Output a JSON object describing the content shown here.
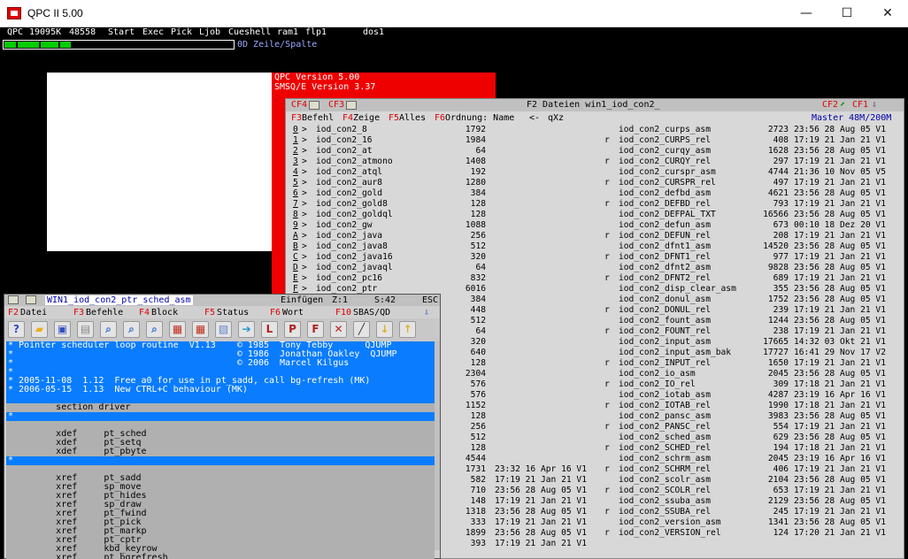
{
  "window": {
    "title": "QPC II 5.00",
    "minimize": "—",
    "maximize": "☐",
    "close": "✕"
  },
  "qbar": {
    "qpc": "QPC",
    "mem": "19095K",
    "free": "48558",
    "start": "Start",
    "exec": "Exec",
    "pick": "Pick",
    "ljob": "Ljob",
    "cueshell": "Cueshell",
    "ram1": "ram1",
    "flp1": "flp1",
    "dos1": "dos1"
  },
  "progress": {
    "label": "0D Zeile/Spalte",
    "fraction": 0.29
  },
  "version": {
    "line1": "QPC Version 5.00",
    "line2": "SMSQ/E Version 3.37"
  },
  "files": {
    "title": "F2 Dateien win1_iod_con2_",
    "title_keys": {
      "cf4": "CF4",
      "cf3": "CF3",
      "cf2": "CF2",
      "cf1": "CF1"
    },
    "menu": {
      "f3": "F3",
      "f3l": "Befehl",
      "f4": "F4",
      "f4l": "Zeige",
      "f5": "F5",
      "f5l": "Alles",
      "f6": "F6",
      "f6l": "Ordnung: Name",
      "sort": "<-",
      "qxz": "qXz",
      "master": "Master 48M/200M"
    },
    "left": [
      {
        "key": "0",
        "name": "iod_con2_8",
        "size": "1792"
      },
      {
        "key": "1",
        "name": "iod_con2_16",
        "size": "1984"
      },
      {
        "key": "2",
        "name": "iod_con2_at",
        "size": "64"
      },
      {
        "key": "3",
        "name": "iod_con2_atmono",
        "size": "1408"
      },
      {
        "key": "4",
        "name": "iod_con2_atql",
        "size": "192"
      },
      {
        "key": "5",
        "name": "iod_con2_aur8",
        "size": "1280"
      },
      {
        "key": "6",
        "name": "iod_con2_gold",
        "size": "384"
      },
      {
        "key": "7",
        "name": "iod_con2_gold8",
        "size": "128"
      },
      {
        "key": "8",
        "name": "iod_con2_goldql",
        "size": "128"
      },
      {
        "key": "9",
        "name": "iod_con2_gw",
        "size": "1088"
      },
      {
        "key": "A",
        "name": "iod_con2_java",
        "size": "256"
      },
      {
        "key": "B",
        "name": "iod_con2_java8",
        "size": "512"
      },
      {
        "key": "C",
        "name": "iod_con2_java16",
        "size": "320"
      },
      {
        "key": "D",
        "name": "iod_con2_javaql",
        "size": "64"
      },
      {
        "key": "E",
        "name": "iod_con2_pc16",
        "size": "832"
      },
      {
        "key": "F",
        "name": "iod_con2_ptr",
        "size": "6016"
      },
      {
        "key": "",
        "name": "",
        "size": "384"
      },
      {
        "key": "",
        "name": "",
        "size": "448"
      },
      {
        "key": "",
        "name": "",
        "size": "512"
      },
      {
        "key": "",
        "name": "",
        "size": "64"
      },
      {
        "key": "",
        "name": "",
        "size": "320"
      },
      {
        "key": "",
        "name": "",
        "size": "640"
      },
      {
        "key": "",
        "name": "",
        "size": "128"
      },
      {
        "key": "",
        "name": "",
        "size": "2304"
      },
      {
        "key": "",
        "name": "",
        "size": "576"
      },
      {
        "key": "",
        "name": "",
        "size": "576"
      },
      {
        "key": "",
        "name": "",
        "size": "1152"
      },
      {
        "key": "",
        "name": "",
        "size": "128"
      },
      {
        "key": "",
        "name": "",
        "size": "256"
      },
      {
        "key": "",
        "name": "",
        "size": "512"
      },
      {
        "key": "",
        "name": "",
        "size": "128"
      },
      {
        "key": "",
        "name": "",
        "size": "4544"
      },
      {
        "key": "",
        "name": "",
        "size": "1731",
        "date": "23:32 16 Apr 16 V1"
      },
      {
        "key": "",
        "name": "",
        "size": "582",
        "date": "17:19 21 Jan 21 V1"
      },
      {
        "key": "",
        "name": "",
        "size": "710",
        "date": "23:56 28 Aug 05 V1"
      },
      {
        "key": "",
        "name": "",
        "size": "148",
        "date": "17:19 21 Jan 21 V1"
      },
      {
        "key": "",
        "name": "",
        "size": "1318",
        "date": "23:56 28 Aug 05 V1"
      },
      {
        "key": "",
        "name": "",
        "size": "333",
        "date": "17:19 21 Jan 21 V1"
      },
      {
        "key": "",
        "name": "",
        "size": "1899",
        "date": "23:56 28 Aug 05 V1"
      },
      {
        "key": "",
        "name": "",
        "size": "393",
        "date": "17:19 21 Jan 21 V1"
      }
    ],
    "right": [
      {
        "r": "",
        "name": "iod_con2_curps_asm",
        "size": "2723",
        "date": "23:56 28 Aug 05 V1"
      },
      {
        "r": "r",
        "name": "iod_con2_CURPS_rel",
        "size": "408",
        "date": "17:19 21 Jan 21 V1"
      },
      {
        "r": "",
        "name": "iod_con2_curqy_asm",
        "size": "1628",
        "date": "23:56 28 Aug 05 V1"
      },
      {
        "r": "r",
        "name": "iod_con2_CURQY_rel",
        "size": "297",
        "date": "17:19 21 Jan 21 V1"
      },
      {
        "r": "",
        "name": "iod_con2_curspr_asm",
        "size": "4744",
        "date": "21:36 10 Nov 05 V5"
      },
      {
        "r": "r",
        "name": "iod_con2_CURSPR_rel",
        "size": "497",
        "date": "17:19 21 Jan 21 V1"
      },
      {
        "r": "",
        "name": "iod_con2_defbd_asm",
        "size": "4621",
        "date": "23:56 28 Aug 05 V1"
      },
      {
        "r": "r",
        "name": "iod_con2_DEFBD_rel",
        "size": "793",
        "date": "17:19 21 Jan 21 V1"
      },
      {
        "r": "",
        "name": "iod_con2_DEFPAL_TXT",
        "size": "16566",
        "date": "23:56 28 Aug 05 V1"
      },
      {
        "r": "",
        "name": "iod_con2_defun_asm",
        "size": "673",
        "date": "00:10 18 Dez 20 V1"
      },
      {
        "r": "r",
        "name": "iod_con2_DEFUN_rel",
        "size": "208",
        "date": "17:19 21 Jan 21 V1"
      },
      {
        "r": "",
        "name": "iod_con2_dfnt1_asm",
        "size": "14520",
        "date": "23:56 28 Aug 05 V1"
      },
      {
        "r": "r",
        "name": "iod_con2_DFNT1_rel",
        "size": "977",
        "date": "17:19 21 Jan 21 V1"
      },
      {
        "r": "",
        "name": "iod_con2_dfnt2_asm",
        "size": "9828",
        "date": "23:56 28 Aug 05 V1"
      },
      {
        "r": "r",
        "name": "iod_con2_DFNT2_rel",
        "size": "689",
        "date": "17:19 21 Jan 21 V1"
      },
      {
        "r": "",
        "name": "iod_con2_disp_clear_asm",
        "size": "355",
        "date": "23:56 28 Aug 05 V1"
      },
      {
        "r": "",
        "name": "iod_con2_donul_asm",
        "size": "1752",
        "date": "23:56 28 Aug 05 V1"
      },
      {
        "r": "r",
        "name": "iod_con2_DONUL_rel",
        "size": "239",
        "date": "17:19 21 Jan 21 V1"
      },
      {
        "r": "",
        "name": "iod_con2_fount_asm",
        "size": "1244",
        "date": "23:56 28 Aug 05 V1"
      },
      {
        "r": "r",
        "name": "iod_con2_FOUNT_rel",
        "size": "238",
        "date": "17:19 21 Jan 21 V1"
      },
      {
        "r": "",
        "name": "iod_con2_input_asm",
        "size": "17665",
        "date": "14:32 03 Okt 21 V1"
      },
      {
        "r": "",
        "name": "iod_con2_input_asm_bak",
        "size": "17727",
        "date": "16:41 29 Nov 17 V2"
      },
      {
        "r": "r",
        "name": "iod_con2_INPUT_rel",
        "size": "1650",
        "date": "17:19 21 Jan 21 V1"
      },
      {
        "r": "",
        "name": "iod_con2_io_asm",
        "size": "2045",
        "date": "23:56 28 Aug 05 V1"
      },
      {
        "r": "r",
        "name": "iod_con2_IO_rel",
        "size": "309",
        "date": "17:18 21 Jan 21 V1"
      },
      {
        "r": "",
        "name": "iod_con2_iotab_asm",
        "size": "4287",
        "date": "23:19 16 Apr 16 V1"
      },
      {
        "r": "r",
        "name": "iod_con2_IOTAB_rel",
        "size": "1990",
        "date": "17:18 21 Jan 21 V1"
      },
      {
        "r": "",
        "name": "iod_con2_pansc_asm",
        "size": "3983",
        "date": "23:56 28 Aug 05 V1"
      },
      {
        "r": "r",
        "name": "iod_con2_PANSC_rel",
        "size": "554",
        "date": "17:19 21 Jan 21 V1"
      },
      {
        "r": "",
        "name": "iod_con2_sched_asm",
        "size": "629",
        "date": "23:56 28 Aug 05 V1"
      },
      {
        "r": "r",
        "name": "iod_con2_SCHED_rel",
        "size": "194",
        "date": "17:18 21 Jan 21 V1"
      },
      {
        "r": "",
        "name": "iod_con2_schrm_asm",
        "size": "2045",
        "date": "23:19 16 Apr 16 V1"
      },
      {
        "r": "r",
        "name": "iod_con2_SCHRM_rel",
        "size": "406",
        "date": "17:19 21 Jan 21 V1"
      },
      {
        "r": "",
        "name": "iod_con2_scolr_asm",
        "size": "2104",
        "date": "23:56 28 Aug 05 V1"
      },
      {
        "r": "r",
        "name": "iod_con2_SCOLR_rel",
        "size": "653",
        "date": "17:19 21 Jan 21 V1"
      },
      {
        "r": "",
        "name": "iod_con2_ssuba_asm",
        "size": "2129",
        "date": "23:56 28 Aug 05 V1"
      },
      {
        "r": "r",
        "name": "iod_con2_SSUBA_rel",
        "size": "245",
        "date": "17:19 21 Jan 21 V1"
      },
      {
        "r": "",
        "name": "iod_con2_version_asm",
        "size": "1341",
        "date": "23:56 28 Aug 05 V1"
      },
      {
        "r": "r",
        "name": "iod_con2_VERSION_rel",
        "size": "124",
        "date": "17:20 21 Jan 21 V1"
      }
    ]
  },
  "editor": {
    "filename": "WIN1_iod_con2_ptr_sched_asm",
    "mode": "Einfügen",
    "zeile": "Z:1",
    "spalte": "S:42",
    "esc": "ESC",
    "menu": {
      "f2": "F2",
      "f2l": "Datei",
      "f3": "F3",
      "f3l": "Befehle",
      "f4": "F4",
      "f4l": "Block",
      "f5": "F5",
      "f5l": "Status",
      "f6": "F6",
      "f6l": "Wort",
      "f10": "F10",
      "f10l": "SBAS/QD"
    },
    "lines": [
      {
        "t": "* Pointer scheduler loop routine  V1.13    © 1985  Tony Tebby      QJUMP",
        "c": "b"
      },
      {
        "t": "*                                          © 1986  Jonathan Oakley  QJUMP",
        "c": "b"
      },
      {
        "t": "*                                          © 2006  Marcel Kilgus",
        "c": "b"
      },
      {
        "t": "*",
        "c": "b"
      },
      {
        "t": "* 2005-11-08  1.12  Free a0 for use in pt_sadd, call bg-refresh (MK)",
        "c": "b"
      },
      {
        "t": "* 2006-05-15  1.13  New CTRL+C behaviour (MK)",
        "c": "b"
      },
      {
        "t": "",
        "c": "b"
      },
      {
        "t": "         section driver",
        "c": "g"
      },
      {
        "t": "*",
        "c": "b"
      },
      {
        "t": "",
        "c": "g"
      },
      {
        "t": "         xdef     pt_sched",
        "c": "g"
      },
      {
        "t": "         xdef     pt_setq",
        "c": "g"
      },
      {
        "t": "         xdef     pt_pbyte",
        "c": "g"
      },
      {
        "t": "*",
        "c": "b"
      },
      {
        "t": "",
        "c": "g"
      },
      {
        "t": "         xref     pt_sadd",
        "c": "g"
      },
      {
        "t": "         xref     sp_move",
        "c": "g"
      },
      {
        "t": "         xref     pt_hides",
        "c": "g"
      },
      {
        "t": "         xref     sp_draw",
        "c": "g"
      },
      {
        "t": "         xref     pt_fwind",
        "c": "g"
      },
      {
        "t": "         xref     pt_pick",
        "c": "g"
      },
      {
        "t": "         xref     pt_markp",
        "c": "g"
      },
      {
        "t": "         xref     pt_cptr",
        "c": "g"
      },
      {
        "t": "         xref     kbd_keyrow",
        "c": "g"
      },
      {
        "t": "         xref     pt_bgrefresh",
        "c": "g"
      }
    ],
    "toolbar": [
      {
        "icon": "help-icon",
        "color": "#2848c8"
      },
      {
        "icon": "open-folder-icon",
        "color": "#e8b020"
      },
      {
        "icon": "save-icon",
        "color": "#3050c0"
      },
      {
        "icon": "print-icon",
        "color": "#888888"
      },
      {
        "icon": "search-icon",
        "color": "#3070d0"
      },
      {
        "icon": "search-next-icon",
        "color": "#3070d0"
      },
      {
        "icon": "replace-icon",
        "color": "#3070d0"
      },
      {
        "icon": "block-copy-icon",
        "color": "#c03020"
      },
      {
        "icon": "block-move-icon",
        "color": "#c03020"
      },
      {
        "icon": "paste-icon",
        "color": "#6080d0"
      },
      {
        "icon": "export-icon",
        "color": "#2090d0"
      },
      {
        "icon": "label-icon",
        "color": "#b02020"
      },
      {
        "icon": "proc-icon",
        "color": "#b02020"
      },
      {
        "icon": "func-icon",
        "color": "#b02020"
      },
      {
        "icon": "cancel-icon",
        "color": "#c02020"
      },
      {
        "icon": "pen-icon",
        "color": "#303030"
      },
      {
        "icon": "arrow-down-icon",
        "color": "#e0b020"
      },
      {
        "icon": "arrow-up-icon",
        "color": "#e0b020"
      }
    ]
  }
}
